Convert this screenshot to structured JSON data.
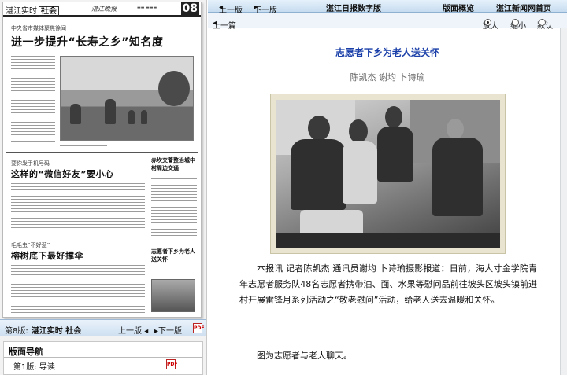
{
  "left_pane": {
    "newspaper": {
      "section_prefix": "湛江实时",
      "section_name": "社会",
      "masthead": "湛江晚报",
      "page_number": "08",
      "story1": {
        "kicker": "中央省市媒体聚焦徐闻",
        "headline": "进一步提升“长寿之乡”知名度"
      },
      "story2": {
        "kicker": "要你发手机号码",
        "headline": "这样的“微信好友”要小心"
      },
      "story3": {
        "kicker": "毛毛虫“不好惹”",
        "headline": "榕树底下最好撑伞"
      },
      "side1": "赤坎交警整治城中村周边交通",
      "side2": "志愿者下乡为老人送关怀"
    },
    "page_bar": {
      "label": "第8版:",
      "name": "湛江实时  社会",
      "prev": "上一版",
      "next": "下一版",
      "pdf": "PDF"
    },
    "nav": {
      "title": "版面导航",
      "item": "第1版:  导读",
      "pdf": "PDF"
    }
  },
  "top_bar": {
    "prev_edition": "上一版",
    "next_edition": "下一版",
    "brand": "湛江日报数字版",
    "browse": "版面概览",
    "home": "湛江新闻网首页"
  },
  "sub_bar": {
    "prev_article": "上一篇",
    "zoom_in": "放大",
    "zoom_out": "缩小",
    "default": "默认"
  },
  "article": {
    "title": "志愿者下乡为老人送关怀",
    "authors": "陈凯杰  谢均  卜诗瑜",
    "body": "本报讯  记者陈凯杰  通讯员谢均  卜诗瑜摄影报道：日前，海大寸金学院青年志愿者服务队48名志愿者携带油、面、水果等慰问品前往坡头区坡头镇前进村开展雷锋月系列活动之“敬老慰问”活动，给老人送去温暖和关怀。",
    "caption": "图为志愿者与老人聊天。"
  }
}
